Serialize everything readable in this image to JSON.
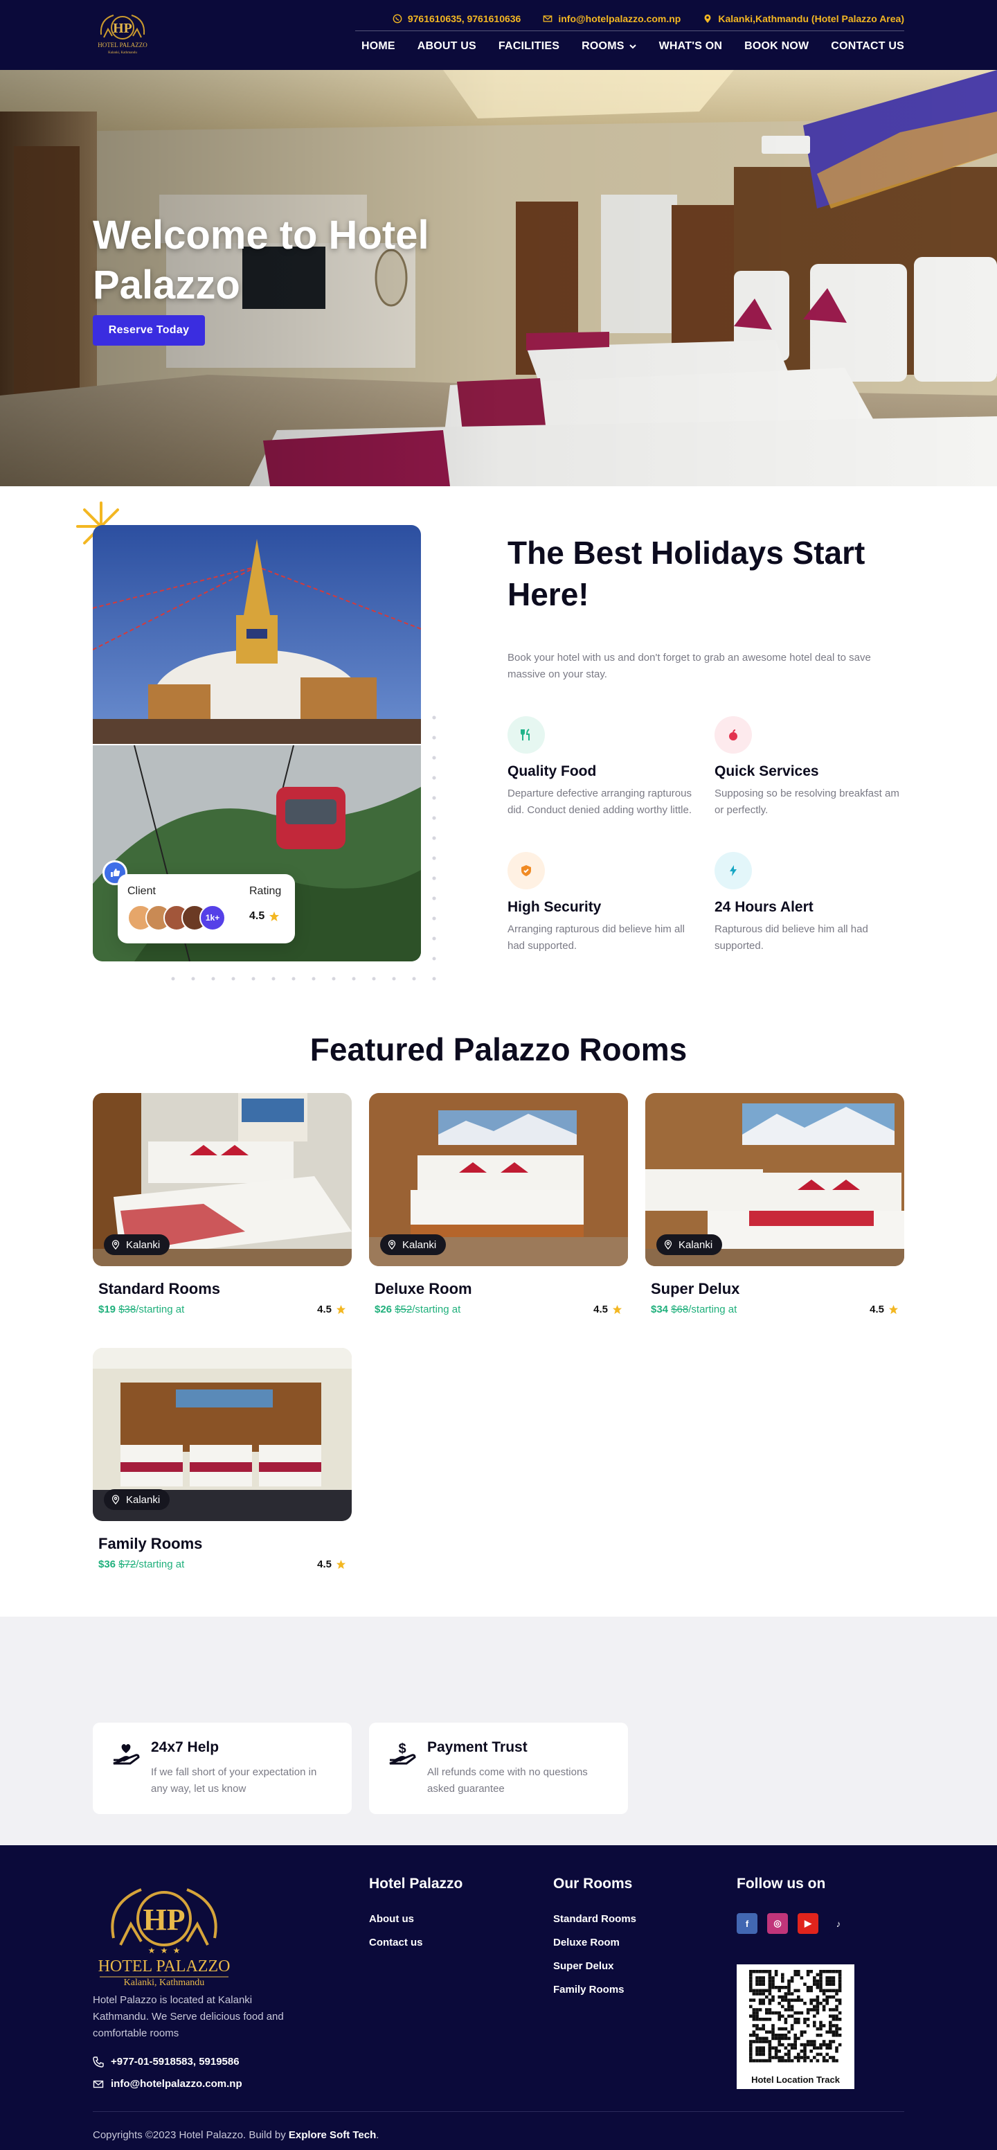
{
  "header": {
    "logo_text": "HOTEL PALAZZO",
    "logo_subtext": "Kalanki, Kathmandu",
    "phone": "9761610635, 9761610636",
    "email": "info@hotelpalazzo.com.np",
    "location": "Kalanki,Kathmandu (Hotel Palazzo Area)",
    "nav": [
      "HOME",
      "ABOUT US",
      "FACILITIES",
      "ROOMS",
      "WHAT'S ON",
      "BOOK NOW",
      "CONTACT US"
    ]
  },
  "hero": {
    "title": "Welcome to Hotel Palazzo",
    "cta": "Reserve Today"
  },
  "about": {
    "client_label": "Client",
    "rating_label": "Rating",
    "client_count": "1k+",
    "rating_value": "4.5",
    "title": "The Best Holidays Start Here!",
    "text": "Book your hotel with us and don't forget to grab an awesome hotel deal to save massive on your stay.",
    "features": [
      {
        "title": "Quality Food",
        "text": "Departure defective arranging rapturous did. Conduct denied adding worthy little.",
        "icon": "utensils-icon",
        "color": "#1fb38a",
        "bg": "#e6f7f1"
      },
      {
        "title": "Quick Services",
        "text": "Supposing so be resolving breakfast am or perfectly.",
        "icon": "apple-icon",
        "color": "#e2334f",
        "bg": "#fdeaed"
      },
      {
        "title": "High Security",
        "text": "Arranging rapturous did believe him all had supported.",
        "icon": "shield-icon",
        "color": "#f08a24",
        "bg": "#fff1e3"
      },
      {
        "title": "24 Hours Alert",
        "text": "Rapturous did believe him all had supported.",
        "icon": "bolt-icon",
        "color": "#18a7c4",
        "bg": "#e3f6fa"
      }
    ]
  },
  "rooms": {
    "title": "Featured Palazzo Rooms",
    "starting_label": "/starting at",
    "items": [
      {
        "name": "Standard Rooms",
        "location": "Kalanki",
        "price": "$19",
        "old_price": "$38",
        "rating": "4.5"
      },
      {
        "name": "Deluxe Room",
        "location": "Kalanki",
        "price": "$26",
        "old_price": "$52",
        "rating": "4.5"
      },
      {
        "name": "Super Delux",
        "location": "Kalanki",
        "price": "$34",
        "old_price": "$68",
        "rating": "4.5"
      },
      {
        "name": "Family Rooms",
        "location": "Kalanki",
        "price": "$36",
        "old_price": "$72",
        "rating": "4.5"
      }
    ]
  },
  "support": [
    {
      "title": "24x7 Help",
      "text": "If we fall short of your expectation in any way, let us know",
      "icon": "hand-heart-icon"
    },
    {
      "title": "Payment Trust",
      "text": "All refunds come with no questions asked guarantee",
      "icon": "hand-dollar-icon"
    }
  ],
  "footer": {
    "description": "Hotel Palazzo is located at Kalanki Kathmandu. We Serve delicious food and comfortable rooms",
    "phone": "+977-01-5918583, 5919586",
    "email": "info@hotelpalazzo.com.np",
    "col1_title": "Hotel Palazzo",
    "col1_links": [
      "About us",
      "Contact us"
    ],
    "col2_title": "Our Rooms",
    "col2_links": [
      "Standard Rooms",
      "Deluxe Room",
      "Super Delux",
      "Family Rooms"
    ],
    "col3_title": "Follow us on",
    "socials": [
      {
        "name": "facebook-icon",
        "glyph": "f",
        "color": "#4267b2"
      },
      {
        "name": "instagram-icon",
        "glyph": "◎",
        "color": "#c1357a"
      },
      {
        "name": "youtube-icon",
        "glyph": "▶",
        "color": "#e1241c"
      },
      {
        "name": "tiktok-icon",
        "glyph": "♪",
        "color": "#0b0a3a"
      }
    ],
    "qr_caption": "Hotel  Location Track",
    "copyright_prefix": "Copyrights ©2023 Hotel Palazzo. Build by ",
    "copyright_brand": "Explore Soft Tech",
    "copyright_suffix": "."
  }
}
